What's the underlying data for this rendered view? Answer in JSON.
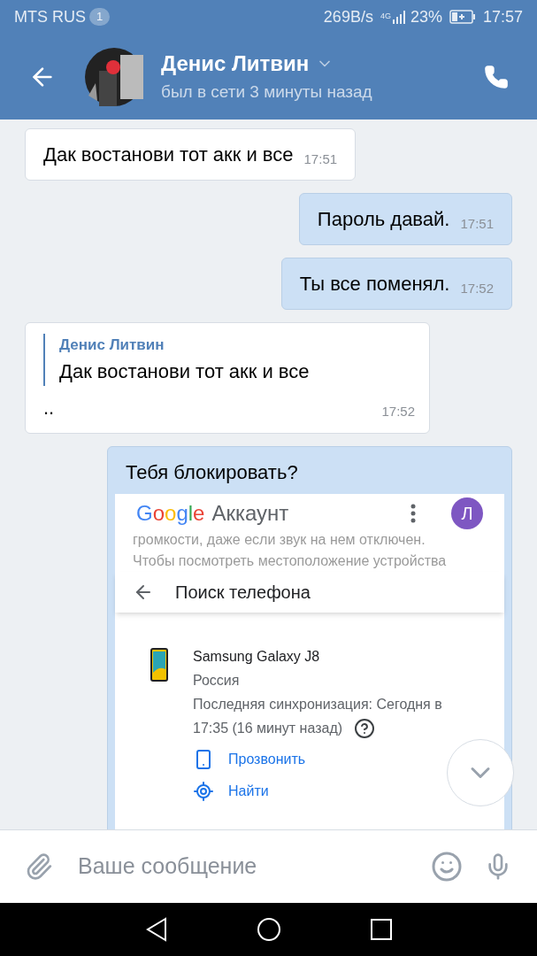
{
  "status_bar": {
    "carrier": "MTS RUS",
    "notification_count": "1",
    "speed": "269B/s",
    "network": "4G",
    "battery": "23%",
    "time": "17:57"
  },
  "header": {
    "name": "Денис Литвин",
    "status": "был в сети 3 минуты назад"
  },
  "messages": [
    {
      "kind": "text",
      "outgoing": false,
      "text": "Дак востанови тот акк и все",
      "time": "17:51"
    },
    {
      "kind": "text",
      "outgoing": true,
      "text": "Пароль давай.",
      "time": "17:51"
    },
    {
      "kind": "text",
      "outgoing": true,
      "text": "Ты все поменял.",
      "time": "17:52"
    },
    {
      "kind": "reply",
      "outgoing": false,
      "quote_author": "Денис Литвин",
      "quote_text": "Дак востанови тот акк и все",
      "text": "..",
      "time": "17:52"
    },
    {
      "kind": "screenshot",
      "outgoing": true,
      "text": "Тебя блокировать?",
      "screenshot": {
        "logo": "Google",
        "title": "Аккаунт",
        "avatar_letter": "Л",
        "faded_lines": [
          "громкости, даже если звук на нем отключен.",
          "Чтобы посмотреть местоположение устройства"
        ],
        "page_title": "Поиск телефона",
        "device": "Samsung Galaxy J8",
        "country": "Россия",
        "sync": "Последняя синхронизация: Сегодня в 17:35 (16 минут назад)",
        "actions": [
          "Прозвонить",
          "Найти"
        ]
      }
    }
  ],
  "composer": {
    "placeholder": "Ваше сообщение"
  }
}
